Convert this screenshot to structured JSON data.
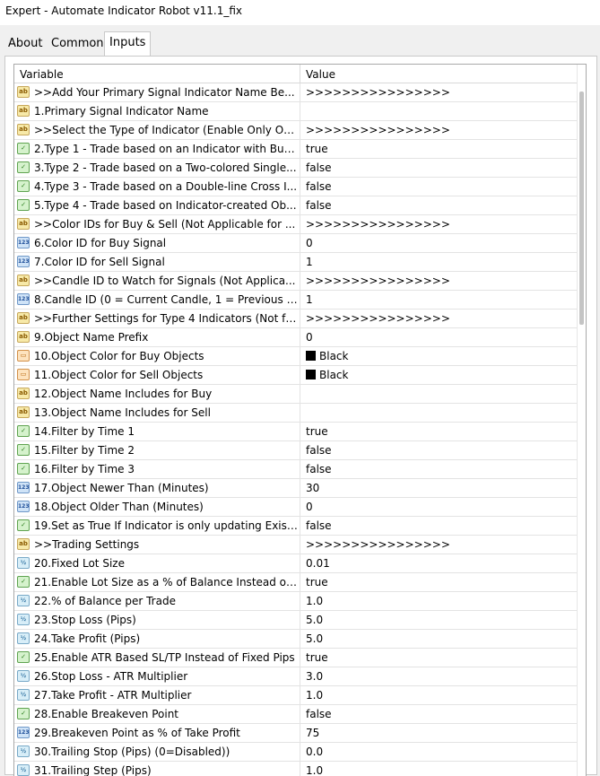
{
  "window": {
    "title": "Expert - Automate Indicator Robot v11.1_fix"
  },
  "tabs": [
    "About",
    "Common",
    "Inputs"
  ],
  "grid": {
    "headers": {
      "variable": "Variable",
      "value": "Value"
    },
    "rows": [
      {
        "icon": "text-icon",
        "label": ">>Add Your Primary Signal Indicator Name Be...",
        "value": ">>>>>>>>>>>>>>>>"
      },
      {
        "icon": "text-icon",
        "label": "1.Primary Signal Indicator Name",
        "value": ""
      },
      {
        "icon": "text-icon",
        "label": ">>Select the Type of Indicator (Enable Only One...",
        "value": ">>>>>>>>>>>>>>>>"
      },
      {
        "icon": "bool-icon",
        "label": "2.Type 1 - Trade based on an Indicator with Buy...",
        "value": "true"
      },
      {
        "icon": "bool-icon",
        "label": "3.Type 2 - Trade based on a Two-colored Single...",
        "value": "false"
      },
      {
        "icon": "bool-icon",
        "label": "4.Type 3 - Trade based on a Double-line Cross I...",
        "value": "false"
      },
      {
        "icon": "bool-icon",
        "label": "5.Type 4 - Trade based on Indicator-created Ob...",
        "value": "false"
      },
      {
        "icon": "text-icon",
        "label": ">>Color IDs for Buy & Sell (Not Applicable for ...",
        "value": ">>>>>>>>>>>>>>>>"
      },
      {
        "icon": "int-icon",
        "label": "6.Color ID for Buy Signal",
        "value": "0"
      },
      {
        "icon": "int-icon",
        "label": "7.Color ID for Sell Signal",
        "value": "1"
      },
      {
        "icon": "text-icon",
        "label": ">>Candle ID to Watch for Signals  (Not Applica...",
        "value": ">>>>>>>>>>>>>>>>"
      },
      {
        "icon": "int-icon",
        "label": "8.Candle ID (0 = Current Candle, 1 = Previous C...",
        "value": "1"
      },
      {
        "icon": "text-icon",
        "label": ">>Further Settings for Type 4 Indicators (Not fo...",
        "value": ">>>>>>>>>>>>>>>>"
      },
      {
        "icon": "text-icon",
        "label": "9.Object Name Prefix",
        "value": "0"
      },
      {
        "icon": "color-icon",
        "label": "10.Object Color for Buy Objects",
        "value": "Black",
        "swatch": "#000000"
      },
      {
        "icon": "color-icon",
        "label": "11.Object Color for Sell Objects",
        "value": "Black",
        "swatch": "#000000"
      },
      {
        "icon": "text-icon",
        "label": "12.Object Name Includes for Buy",
        "value": ""
      },
      {
        "icon": "text-icon",
        "label": "13.Object Name Includes for Sell",
        "value": ""
      },
      {
        "icon": "bool-icon",
        "label": "14.Filter by Time 1",
        "value": "true"
      },
      {
        "icon": "bool-icon",
        "label": "15.Filter by Time 2",
        "value": "false"
      },
      {
        "icon": "bool-icon",
        "label": "16.Filter by Time 3",
        "value": "false"
      },
      {
        "icon": "int-icon",
        "label": "17.Object Newer Than (Minutes)",
        "value": "30"
      },
      {
        "icon": "int-icon",
        "label": "18.Object Older Than (Minutes)",
        "value": "0"
      },
      {
        "icon": "bool-icon",
        "label": "19.Set as True If Indicator is only updating Existi...",
        "value": "false"
      },
      {
        "icon": "text-icon",
        "label": ">>Trading Settings",
        "value": ">>>>>>>>>>>>>>>>"
      },
      {
        "icon": "double-icon",
        "label": "20.Fixed Lot Size",
        "value": "0.01"
      },
      {
        "icon": "bool-icon",
        "label": "21.Enable Lot Size as a % of Balance Instead of ...",
        "value": "true"
      },
      {
        "icon": "double-icon",
        "label": "22.% of Balance per Trade",
        "value": "1.0"
      },
      {
        "icon": "double-icon",
        "label": "23.Stop Loss (Pips)",
        "value": "5.0"
      },
      {
        "icon": "double-icon",
        "label": "24.Take Profit (Pips)",
        "value": "5.0"
      },
      {
        "icon": "bool-icon",
        "label": "25.Enable ATR Based SL/TP Instead of Fixed Pips",
        "value": "true"
      },
      {
        "icon": "double-icon",
        "label": "26.Stop Loss - ATR Multiplier",
        "value": "3.0"
      },
      {
        "icon": "double-icon",
        "label": "27.Take Profit - ATR Multiplier",
        "value": "1.0"
      },
      {
        "icon": "bool-icon",
        "label": "28.Enable Breakeven Point",
        "value": "false"
      },
      {
        "icon": "int-icon",
        "label": "29.Breakeven Point as % of Take Profit",
        "value": "75"
      },
      {
        "icon": "double-icon",
        "label": "30.Trailing Stop (Pips) (0=Disabled))",
        "value": "0.0"
      },
      {
        "icon": "double-icon",
        "label": "31.Trailing Step (Pips)",
        "value": "1.0"
      }
    ]
  },
  "icon_glyphs": {
    "text-icon": "ab",
    "bool-icon": "✓",
    "int-icon": "123",
    "double-icon": "½",
    "color-icon": "▭"
  }
}
